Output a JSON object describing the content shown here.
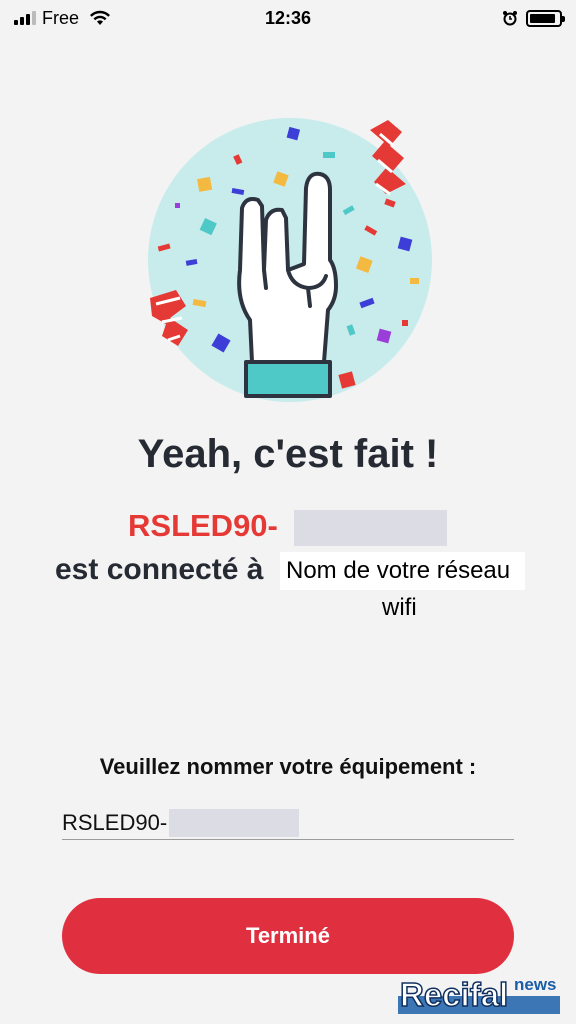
{
  "status_bar": {
    "carrier": "Free",
    "time": "12:36",
    "battery_level": 0.9,
    "icons": [
      "signal-icon",
      "wifi-icon",
      "alarm-icon",
      "battery-icon"
    ]
  },
  "illustration": {
    "name": "rock-hand-confetti-icon",
    "colors": {
      "circle": "#c8ecec",
      "cuff": "#4fc9c7",
      "streamer_red": "#e53935"
    }
  },
  "title": "Yeah, c'est fait !",
  "device_name": "RSLED90-",
  "connected_text": "est connecté à",
  "network_placeholder": "Nom de votre réseau",
  "network_placeholder_line2": "wifi",
  "name_prompt": "Veuillez nommer votre équipement :",
  "name_input_value": "RSLED90-",
  "done_button": "Terminé",
  "watermark": {
    "word": "Recifal",
    "sub": "news"
  },
  "colors": {
    "accent_red": "#e03040",
    "device_red": "#e53935",
    "text_dark": "#262a33",
    "background": "#f3f3f3"
  }
}
